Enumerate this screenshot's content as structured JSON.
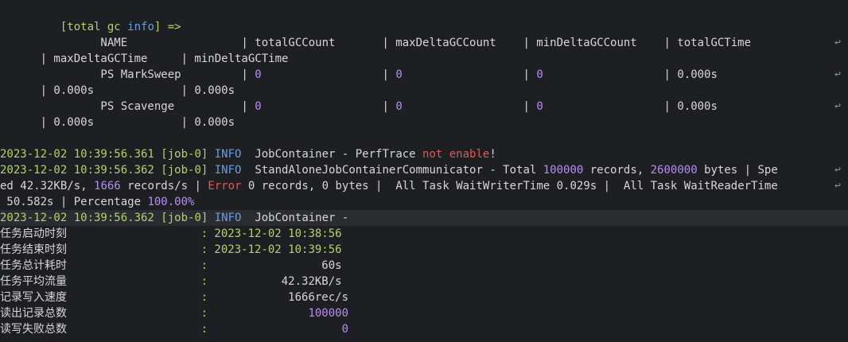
{
  "colors": {
    "background": "#1e1f22",
    "text": "#d7d7d7",
    "green": "#b3d36a",
    "cyan": "#5ec0c6",
    "blue": "#6a9de0",
    "purple": "#b98df0",
    "red": "#e05a5a",
    "wrap_marker": "#5aa7c7"
  },
  "lines": [
    {
      "segs": [
        {
          "t": "         [total gc ",
          "c": "green"
        },
        {
          "t": "info",
          "c": "blue"
        },
        {
          "t": "] =>",
          "c": "green"
        }
      ]
    },
    {
      "segs": [
        {
          "t": "               NAME                 | totalGCCount       | maxDeltaGCCount    | minDeltaGCCount    | totalGCTime  ",
          "c": "text"
        }
      ],
      "wrap": true
    },
    {
      "segs": [
        {
          "t": "      | maxDeltaGCTime     | minDeltaGCTime",
          "c": "text"
        }
      ]
    },
    {
      "segs": [
        {
          "t": "               PS MarkSweep         | ",
          "c": "text"
        },
        {
          "t": "0",
          "c": "purple"
        },
        {
          "t": "                  | ",
          "c": "text"
        },
        {
          "t": "0",
          "c": "purple"
        },
        {
          "t": "                  | ",
          "c": "text"
        },
        {
          "t": "0",
          "c": "purple"
        },
        {
          "t": "                  | 0.000s       ",
          "c": "text"
        }
      ],
      "wrap": true
    },
    {
      "segs": [
        {
          "t": "      | 0.000s             | 0.000s",
          "c": "text"
        }
      ]
    },
    {
      "segs": [
        {
          "t": "               PS Scavenge          | ",
          "c": "text"
        },
        {
          "t": "0",
          "c": "purple"
        },
        {
          "t": "                  | ",
          "c": "text"
        },
        {
          "t": "0",
          "c": "purple"
        },
        {
          "t": "                  | ",
          "c": "text"
        },
        {
          "t": "0",
          "c": "purple"
        },
        {
          "t": "                  | 0.000s       ",
          "c": "text"
        }
      ],
      "wrap": true
    },
    {
      "segs": [
        {
          "t": "      | 0.000s             | 0.000s",
          "c": "text"
        }
      ]
    },
    {
      "segs": [
        {
          "t": "",
          "c": "text"
        }
      ]
    },
    {
      "segs": [
        {
          "t": "2023-12-02 10:39:56.361 ",
          "c": "green"
        },
        {
          "t": "[job-0] ",
          "c": "green"
        },
        {
          "t": "INFO  ",
          "c": "blue"
        },
        {
          "t": "JobContainer - PerfTrace ",
          "c": "text"
        },
        {
          "t": "not enable",
          "c": "red"
        },
        {
          "t": "!",
          "c": "text"
        }
      ]
    },
    {
      "segs": [
        {
          "t": "2023-12-02 10:39:56.362 ",
          "c": "green"
        },
        {
          "t": "[job-0] ",
          "c": "green"
        },
        {
          "t": "INFO  ",
          "c": "blue"
        },
        {
          "t": "StandAloneJobContainerCommunicator - Total ",
          "c": "text"
        },
        {
          "t": "100000",
          "c": "purple"
        },
        {
          "t": " records, ",
          "c": "text"
        },
        {
          "t": "2600000",
          "c": "purple"
        },
        {
          "t": " bytes | Spe",
          "c": "text"
        }
      ],
      "wrap": true
    },
    {
      "segs": [
        {
          "t": "ed 42.32KB/s, ",
          "c": "text"
        },
        {
          "t": "1666",
          "c": "purple"
        },
        {
          "t": " records/s | ",
          "c": "text"
        },
        {
          "t": "Error",
          "c": "red"
        },
        {
          "t": " 0 records, 0 bytes |  All Task WaitWriterTime 0.029s |  All Task WaitReaderTime",
          "c": "text"
        }
      ],
      "wrap": true
    },
    {
      "segs": [
        {
          "t": " 50.582s | Percentage ",
          "c": "text"
        },
        {
          "t": "100.00%",
          "c": "purple"
        }
      ]
    },
    {
      "segs": [
        {
          "t": "2023-12-02 10:39:56.362 ",
          "c": "green"
        },
        {
          "t": "[job-0] ",
          "c": "green"
        },
        {
          "t": "INFO  ",
          "c": "blue"
        },
        {
          "t": "JobContainer -",
          "c": "text"
        }
      ],
      "highlight": true
    },
    {
      "segs": [
        {
          "t": "任务启动时刻                    ",
          "c": "text"
        },
        {
          "t": ": 2023-12-02 10:38:56",
          "c": "green"
        }
      ]
    },
    {
      "segs": [
        {
          "t": "任务结束时刻                    ",
          "c": "text"
        },
        {
          "t": ": 2023-12-02 10:39:56",
          "c": "green"
        }
      ]
    },
    {
      "segs": [
        {
          "t": "任务总计耗时                    ",
          "c": "text"
        },
        {
          "t": ":",
          "c": "green"
        },
        {
          "t": "                 60s",
          "c": "text"
        }
      ]
    },
    {
      "segs": [
        {
          "t": "任务平均流量                    ",
          "c": "text"
        },
        {
          "t": ":",
          "c": "green"
        },
        {
          "t": "           42.32KB/s",
          "c": "text"
        }
      ]
    },
    {
      "segs": [
        {
          "t": "记录写入速度                    ",
          "c": "text"
        },
        {
          "t": ":",
          "c": "green"
        },
        {
          "t": "            1666rec/s",
          "c": "text"
        }
      ]
    },
    {
      "segs": [
        {
          "t": "读出记录总数                    ",
          "c": "text"
        },
        {
          "t": ":",
          "c": "green"
        },
        {
          "t": "               ",
          "c": "text"
        },
        {
          "t": "100000",
          "c": "purple"
        }
      ]
    },
    {
      "segs": [
        {
          "t": "读写失败总数                    ",
          "c": "text"
        },
        {
          "t": ":",
          "c": "green"
        },
        {
          "t": "                    ",
          "c": "text"
        },
        {
          "t": "0",
          "c": "purple"
        }
      ]
    }
  ],
  "wrap_glyph": "↩"
}
